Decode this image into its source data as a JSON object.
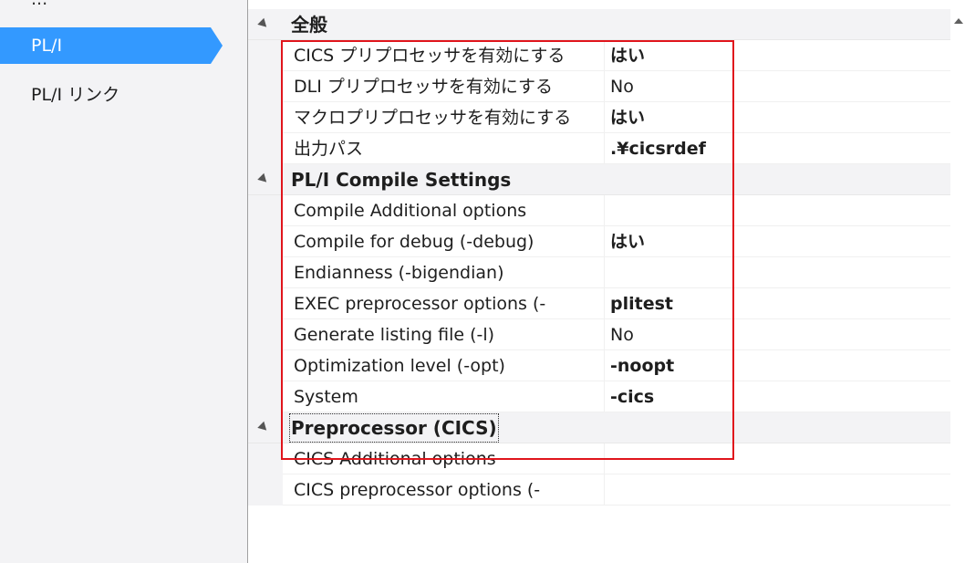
{
  "nav": {
    "clipped_label": "...",
    "items": [
      {
        "label": "PL/I",
        "selected": true
      },
      {
        "label": "PL/I リンク",
        "selected": false
      }
    ]
  },
  "colors": {
    "selection": "#3399ff",
    "highlight_border": "#e0151c",
    "category_bg": "#f3f3f5"
  },
  "categories": [
    {
      "label": "全般",
      "properties": [
        {
          "name": "CICS プリプロセッサを有効にする",
          "value": "はい",
          "bold": true
        },
        {
          "name": "DLI プリプロセッサを有効にする",
          "value": "No",
          "bold": false
        },
        {
          "name": "マクロプリプロセッサを有効にする",
          "value": "はい",
          "bold": true
        },
        {
          "name": "出力パス",
          "value": ".¥cicsrdef",
          "bold": true
        }
      ]
    },
    {
      "label": "PL/I Compile Settings",
      "properties": [
        {
          "name": "Compile Additional options",
          "value": "",
          "bold": false
        },
        {
          "name": "Compile for debug (-debug)",
          "value": "はい",
          "bold": true
        },
        {
          "name": "Endianness (-bigendian)",
          "value": "",
          "bold": false
        },
        {
          "name": "EXEC preprocessor options (-",
          "value": "plitest",
          "bold": true
        },
        {
          "name": "Generate listing file (-l)",
          "value": "No",
          "bold": false
        },
        {
          "name": "Optimization level (-opt)",
          "value": "-noopt",
          "bold": true
        },
        {
          "name": "System",
          "value": "-cics",
          "bold": true
        }
      ]
    },
    {
      "label": "Preprocessor (CICS)",
      "focused": true,
      "properties": [
        {
          "name": "CICS Additional options",
          "value": "",
          "bold": false
        },
        {
          "name": "CICS preprocessor options (-",
          "value": "",
          "bold": false
        }
      ]
    }
  ]
}
